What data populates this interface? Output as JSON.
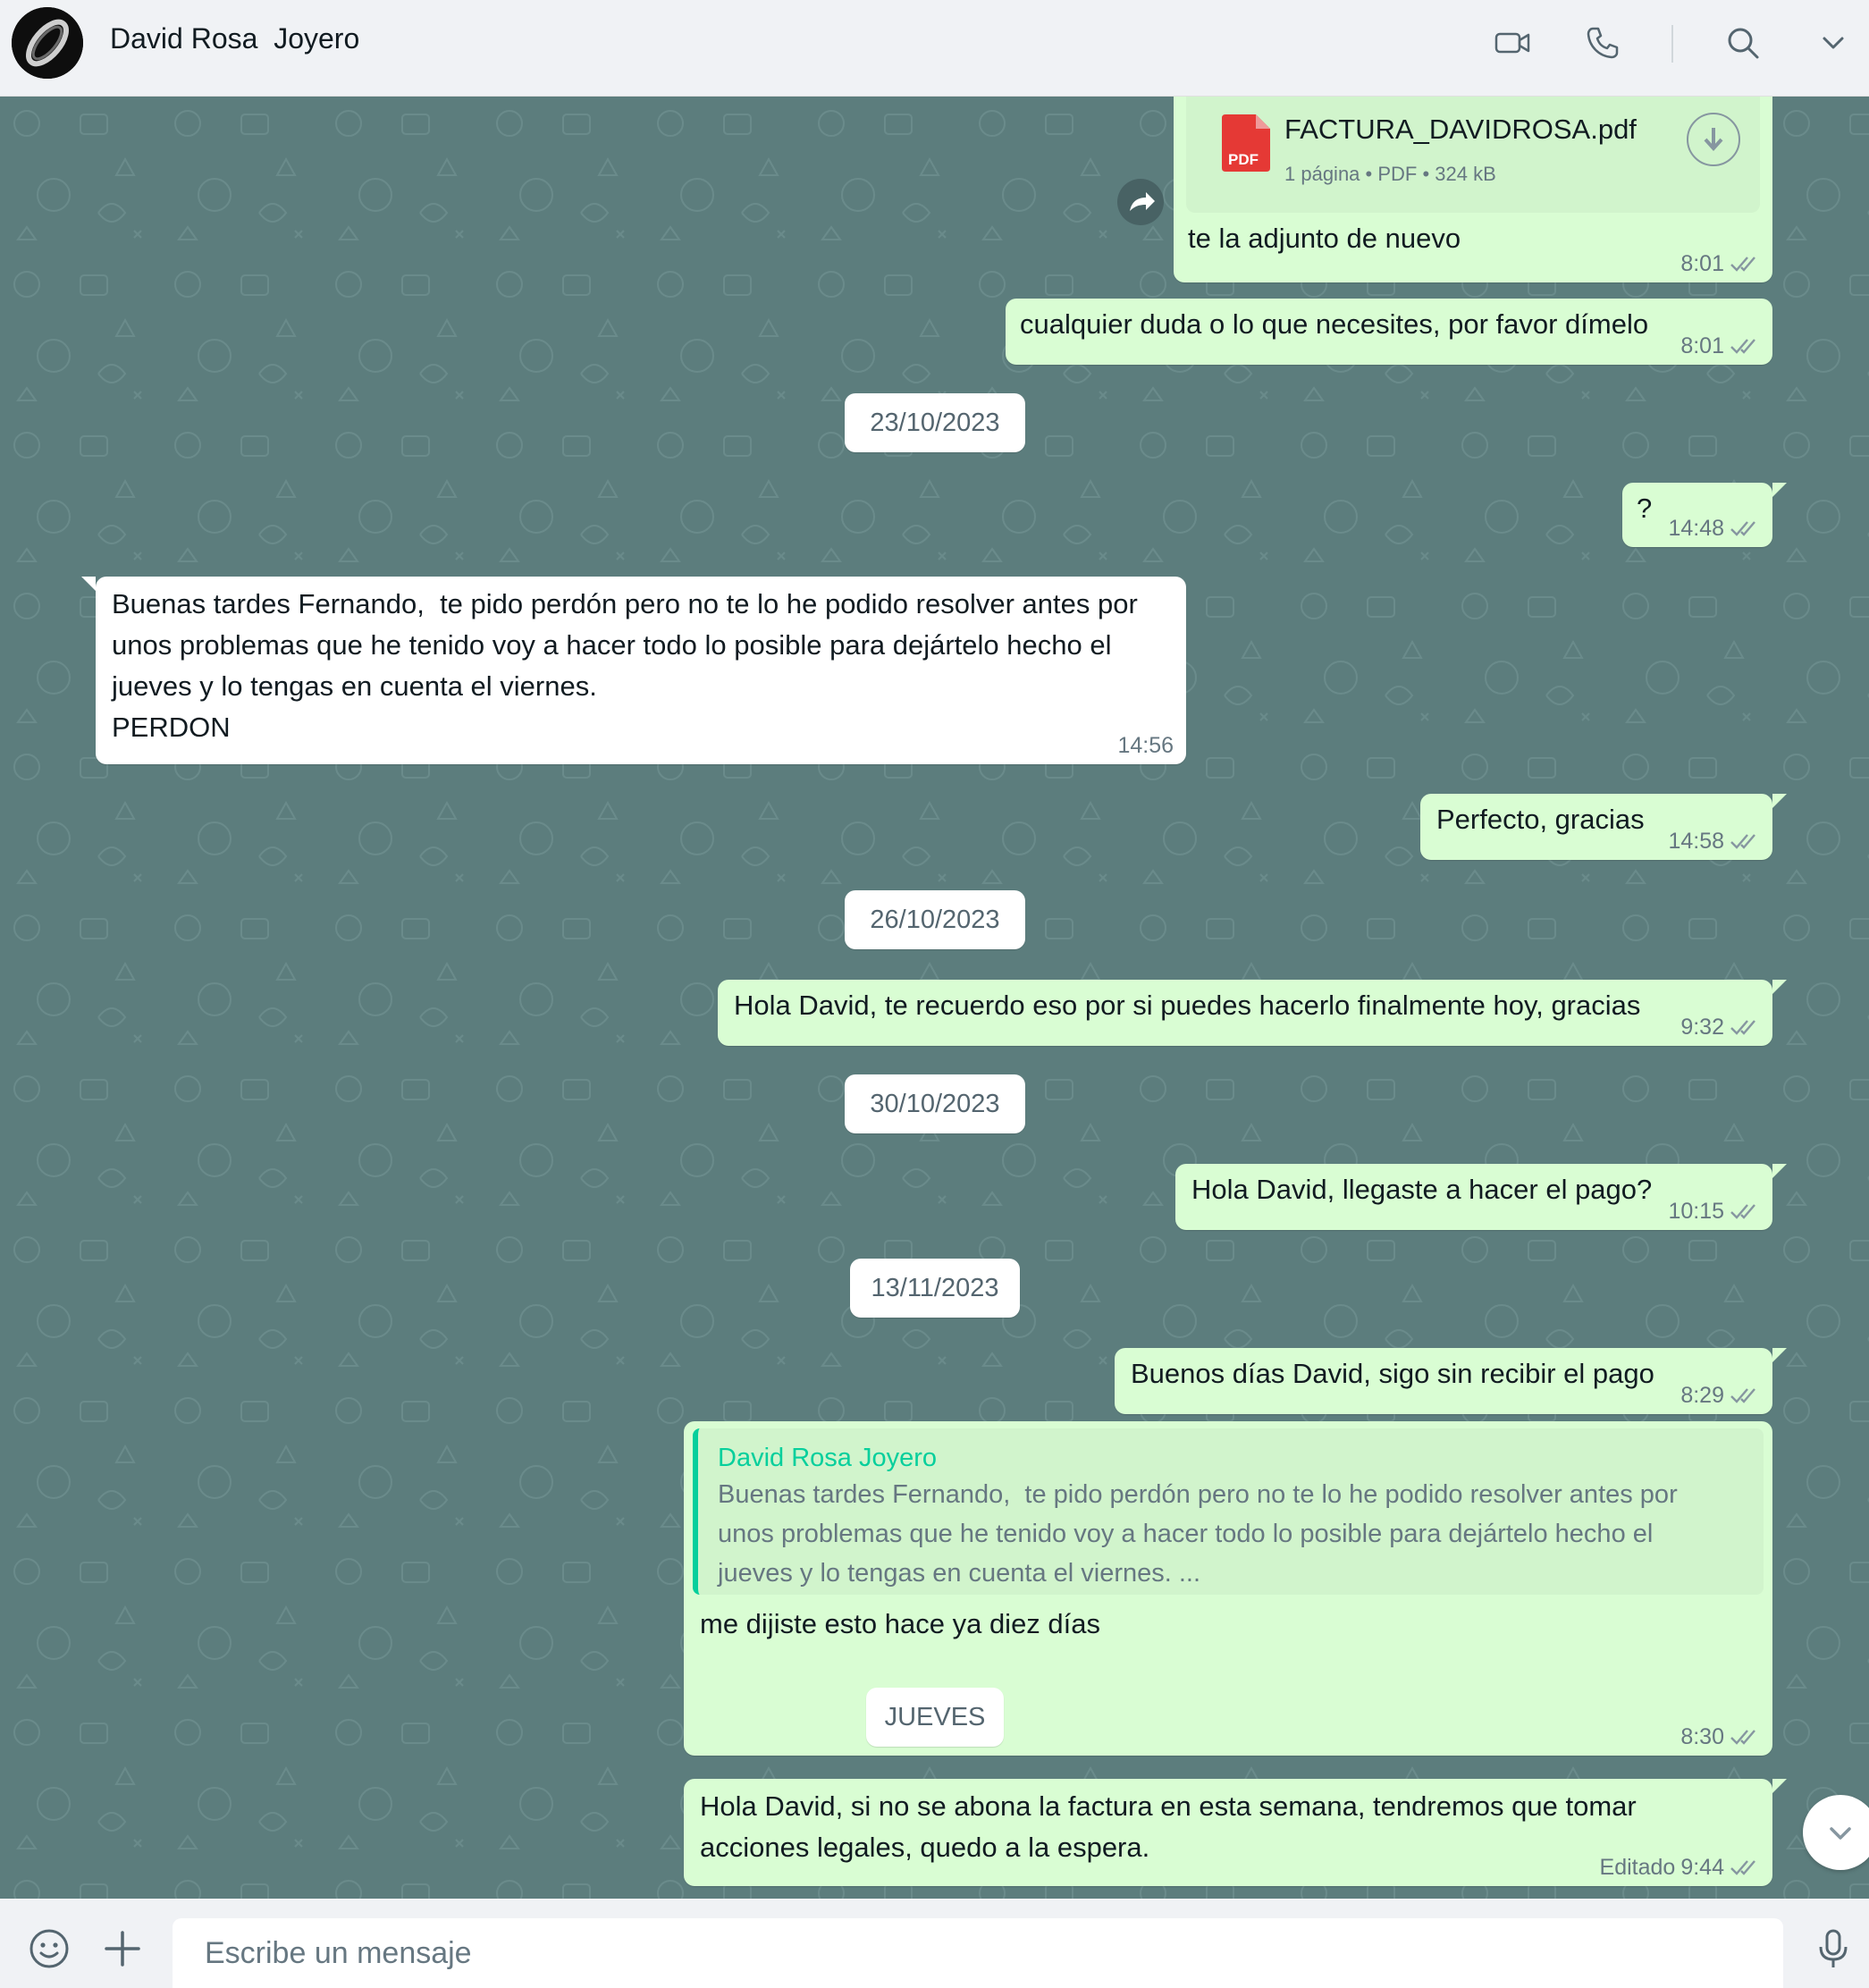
{
  "header": {
    "contact_name": "David Rosa  Joyero",
    "icons": [
      "video-call-icon",
      "voice-call-icon",
      "search-icon",
      "chevron-down-icon"
    ]
  },
  "file_message": {
    "file_name": "FACTURA_DAVIDROSA.pdf",
    "file_info": "1 página • PDF • 324 kB",
    "file_type_label": "PDF",
    "caption": "te la adjunto de nuevo",
    "time": "8:01"
  },
  "messages": [
    {
      "text": "cualquier duda o lo que necesites, por favor dímelo",
      "time": "8:01"
    },
    {
      "text": "?",
      "time": "14:48"
    },
    {
      "text": "Buenas tardes Fernando,  te pido perdón pero no te lo he podido resolver antes por\nunos problemas que he tenido voy a hacer todo lo posible para dejártelo hecho el\njueves y lo tengas en cuenta el viernes.\nPERDON",
      "time": "14:56"
    },
    {
      "text": "Perfecto, gracias",
      "time": "14:58"
    },
    {
      "text": "Hola David, te recuerdo eso por si puedes hacerlo finalmente hoy, gracias",
      "time": "9:32"
    },
    {
      "text": "Hola David, llegaste a hacer el pago?",
      "time": "10:15"
    },
    {
      "text": "Buenos días David, sigo sin recibir el pago",
      "time": "8:29"
    },
    {
      "text": "me dijiste esto hace ya diez días",
      "time": "8:30"
    },
    {
      "text": "Hola David, si no se abona la factura en esta semana, tendremos que tomar\nacciones legales, quedo a la espera.",
      "time": "9:44",
      "edited_label": "Editado"
    }
  ],
  "quote": {
    "author": "David Rosa Joyero",
    "text": "Buenas tardes Fernando,  te pido perdón pero no te lo he podido resolver antes por\nunos problemas que he tenido voy a hacer todo lo posible para dejártelo hecho el\njueves y lo tengas en cuenta el viernes. ..."
  },
  "date_separators": [
    "23/10/2023",
    "26/10/2023",
    "30/10/2023",
    "13/11/2023",
    "JUEVES"
  ],
  "composer": {
    "placeholder": "Escribe un mensaje",
    "icons": [
      "emoji-icon",
      "plus-icon",
      "microphone-icon"
    ]
  },
  "colors": {
    "chat_background": "#5c7d7d",
    "outgoing_bubble": "#d9fdd3",
    "incoming_bubble": "#ffffff",
    "quote_accent": "#06cf9c",
    "pdf_red": "#e53935"
  }
}
